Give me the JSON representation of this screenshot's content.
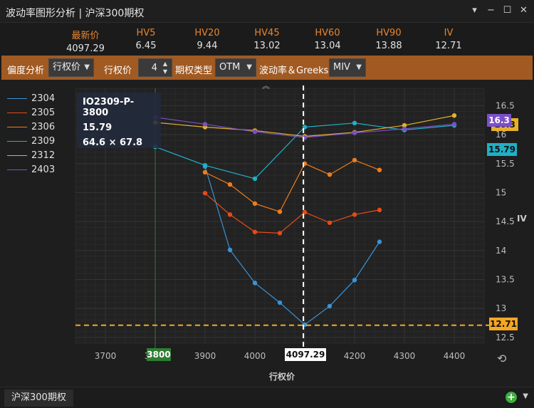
{
  "window": {
    "title": "波动率图形分析 | 沪深300期权"
  },
  "stats": [
    {
      "label": "最新价",
      "value": "4097.29"
    },
    {
      "label": "HV5",
      "value": "6.45"
    },
    {
      "label": "HV20",
      "value": "9.44"
    },
    {
      "label": "HV45",
      "value": "13.02"
    },
    {
      "label": "HV60",
      "value": "13.04"
    },
    {
      "label": "HV90",
      "value": "13.88"
    },
    {
      "label": "IV",
      "value": "12.71"
    }
  ],
  "toolbar": {
    "bias_label": "偏度分析",
    "bias_value": "行权价",
    "strike_label": "行权价",
    "strike_count": "4",
    "option_type_label": "期权类型",
    "option_type_value": "OTM",
    "vol_label": "波动率＆Greeks",
    "vol_value": "MIV"
  },
  "legend": [
    {
      "name": "2304",
      "color": "#3a93d6"
    },
    {
      "name": "2305",
      "color": "#e64a19"
    },
    {
      "name": "2306",
      "color": "#ef7d1a"
    },
    {
      "name": "2309",
      "color": "#1fb0c6"
    },
    {
      "name": "2312",
      "color": "#e6b02a"
    },
    {
      "name": "2403",
      "color": "#7b4fc7"
    }
  ],
  "tooltip": {
    "contract": "IO2309-P-3800",
    "value": "15.79",
    "bidask": "64.6 × 67.8"
  },
  "tags": {
    "x_cursor": "3800",
    "x_spot": "4097.29",
    "iv_line": "12.71",
    "purple": "16.3",
    "teal": "15.79",
    "yellow_partial": "16.3"
  },
  "axes": {
    "y_title": "IV",
    "x_title": "行权价"
  },
  "bottom": {
    "tab": "沪深300期权"
  },
  "chart_data": {
    "type": "line",
    "xlabel": "行权价",
    "ylabel": "IV",
    "xlim": [
      3640,
      4460
    ],
    "ylim": [
      12.4,
      16.8
    ],
    "x_ticks": [
      3700,
      3800,
      3900,
      4000,
      4100,
      4200,
      4300,
      4400
    ],
    "y_ticks": [
      12.5,
      13,
      13.5,
      14,
      14.5,
      15,
      15.5,
      16,
      16.5
    ],
    "hline": 12.71,
    "vline": 4097.29,
    "cursor_x": 3800,
    "series": [
      {
        "name": "2304",
        "color": "#3a93d6",
        "x": [
          3900,
          3950,
          4000,
          4050,
          4100,
          4150,
          4200,
          4250
        ],
        "y": [
          15.45,
          14.01,
          13.44,
          13.1,
          12.72,
          13.04,
          13.49,
          14.15
        ]
      },
      {
        "name": "2305",
        "color": "#e64a19",
        "x": [
          3900,
          3950,
          4000,
          4050,
          4100,
          4150,
          4200,
          4250
        ],
        "y": [
          14.99,
          14.62,
          14.32,
          14.3,
          14.66,
          14.48,
          14.62,
          14.7
        ]
      },
      {
        "name": "2306",
        "color": "#ef7d1a",
        "x": [
          3900,
          3950,
          4000,
          4050,
          4100,
          4150,
          4200,
          4250
        ],
        "y": [
          15.35,
          15.14,
          14.81,
          14.67,
          15.5,
          15.31,
          15.56,
          15.39
        ]
      },
      {
        "name": "2309",
        "color": "#1fb0c6",
        "x": [
          3800,
          3900,
          4000,
          4100,
          4200,
          4300,
          4400
        ],
        "y": [
          15.79,
          15.47,
          15.24,
          16.13,
          16.2,
          16.08,
          16.16
        ]
      },
      {
        "name": "2312",
        "color": "#e6b02a",
        "x": [
          3800,
          3900,
          4000,
          4100,
          4200,
          4300,
          4400
        ],
        "y": [
          16.21,
          16.13,
          16.07,
          15.97,
          16.04,
          16.16,
          16.33
        ]
      },
      {
        "name": "2403",
        "color": "#7b4fc7",
        "x": [
          3800,
          3900,
          4000,
          4100,
          4200,
          4300,
          4400
        ],
        "y": [
          16.3,
          16.18,
          16.05,
          15.95,
          16.03,
          16.1,
          16.18
        ]
      }
    ]
  }
}
